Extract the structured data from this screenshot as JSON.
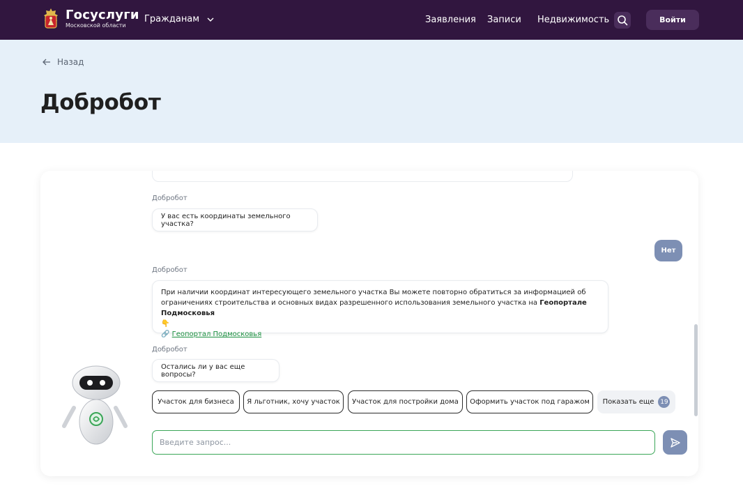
{
  "header": {
    "logo_title": "Госуслуги",
    "logo_subtitle": "Московской области",
    "nav_citizens": "Гражданам",
    "nav_links": [
      "Заявления",
      "Записи",
      "Недвижимость"
    ],
    "login_label": "Войти",
    "search_icon": "search-icon",
    "colors": {
      "background": "#31163f",
      "button": "#4a2d5b"
    }
  },
  "hero": {
    "back_label": "Назад",
    "title": "Добробот",
    "background": "#e6f0f9"
  },
  "chat": {
    "messages": [
      {
        "sender": "Добробот",
        "text": "У вас есть координаты земельного участка?"
      },
      {
        "sender": "user",
        "text": "Нет"
      },
      {
        "sender": "Добробот",
        "line1": "При наличии координат интересующего земельного участка Вы можете повторно обратиться за информацией об",
        "line2": "ограничениях строительства и основных видах разрешенного использования земельного участка на",
        "bold": "Геопортале Подмосковья",
        "emoji_point": "👇",
        "emoji_link": "🔗",
        "link": "Геопортал Подмосковья"
      },
      {
        "sender": "Добробот",
        "text": "Остались ли у вас еще вопросы?"
      }
    ],
    "quick_replies": [
      "Участок для бизнеса",
      "Я льготник, хочу участок",
      "Участок для постройки дома",
      "Оформить участок под гаражом"
    ],
    "show_more_label": "Показать еще",
    "show_more_count": "19",
    "input_placeholder": "Введите запрос...",
    "colors": {
      "accent": "#7d8fb4",
      "input_border": "#3aa657",
      "link": "#1a8f3f"
    }
  }
}
